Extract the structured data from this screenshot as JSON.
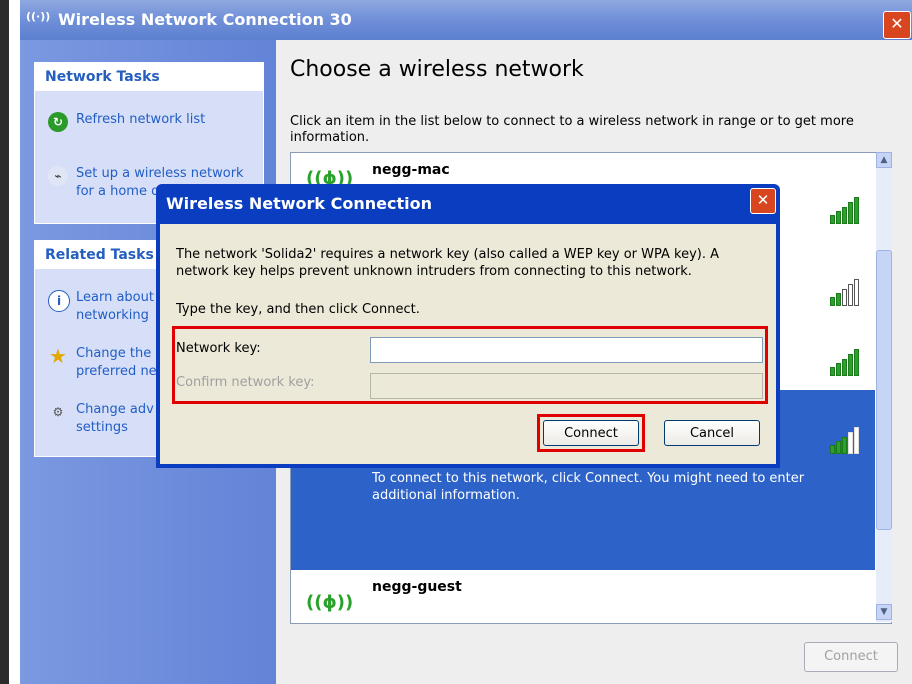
{
  "window": {
    "title": "Wireless Network Connection 30",
    "title_icon": "((·))",
    "close_label": "✕"
  },
  "sidebar": {
    "network_tasks": {
      "header": "Network Tasks",
      "items": [
        {
          "label": "Refresh network list",
          "icon": "refresh-icon"
        },
        {
          "label": "Set up a wireless network",
          "label2": "for a home o",
          "icon": "setup-wizard-icon"
        }
      ]
    },
    "related_tasks": {
      "header": "Related Tasks",
      "items": [
        {
          "label": "Learn about",
          "label2": "networking",
          "icon": "info-icon"
        },
        {
          "label": "Change the",
          "label2": "preferred ne",
          "icon": "star-icon"
        },
        {
          "label": "Change adv",
          "label2": "settings",
          "icon": "settings-icon"
        }
      ]
    }
  },
  "main": {
    "heading": "Choose a wireless network",
    "instructions": "Click an item in the list below to connect to a wireless network in range or to get more information.",
    "networks": [
      {
        "name": "negg-mac"
      },
      {
        "name": "negg-guest"
      }
    ],
    "selected_help": "To connect to this network, click Connect. You might need to enter additional information.",
    "connect_button": "Connect"
  },
  "dialog": {
    "title": "Wireless Network Connection",
    "close_label": "✕",
    "message": "The network 'Solida2' requires a network key (also called a WEP key or WPA key). A network key helps prevent unknown intruders from connecting to this network.",
    "instruction": "Type the key, and then click Connect.",
    "network_key_label": "Network key:",
    "confirm_key_label": "Confirm network key:",
    "network_key_value": "",
    "confirm_key_value": "",
    "connect_button": "Connect",
    "cancel_button": "Cancel"
  },
  "colors": {
    "highlight": "#e00000",
    "title_bar": "#0a3dbf",
    "selected_row": "#2d63c9",
    "signal": "#2aa12a"
  }
}
